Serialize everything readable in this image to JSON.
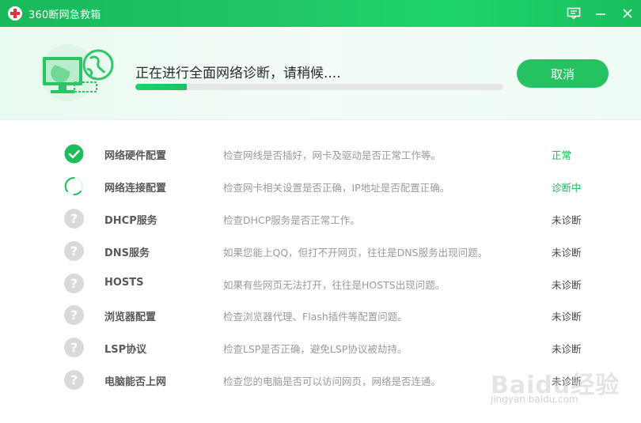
{
  "app": {
    "title": "360断网急救箱",
    "accent": "#21c765"
  },
  "titlebar": {
    "icons": [
      "feedback-icon",
      "minimize-icon",
      "close-icon"
    ]
  },
  "header": {
    "status_text": "正在进行全面网络诊断，请稍候....",
    "progress_fraction": 0.14,
    "cancel_label": "取消"
  },
  "checks": [
    {
      "icon": "check-icon",
      "name": "网络硬件配置",
      "desc": "检查网线是否插好，网卡及驱动是否正常工作等。",
      "status": "正常",
      "state": "ok"
    },
    {
      "icon": "spinner-icon",
      "name": "网络连接配置",
      "desc": "检查网卡相关设置是否正确，IP地址是否配置正确。",
      "status": "诊断中",
      "state": "working"
    },
    {
      "icon": "question-icon",
      "name": "DHCP服务",
      "desc": "检查DHCP服务是否正常工作。",
      "status": "未诊断",
      "state": "pending"
    },
    {
      "icon": "question-icon",
      "name": "DNS服务",
      "desc": "如果您能上QQ，但打不开网页，往往是DNS服务出现问题。",
      "status": "未诊断",
      "state": "pending"
    },
    {
      "icon": "question-icon",
      "name": "HOSTS",
      "desc": "如果有些网页无法打开，往往是HOSTS出现问题。",
      "status": "未诊断",
      "state": "pending"
    },
    {
      "icon": "question-icon",
      "name": "浏览器配置",
      "desc": "检查浏览器代理、Flash插件等配置问题。",
      "status": "未诊断",
      "state": "pending"
    },
    {
      "icon": "question-icon",
      "name": "LSP协议",
      "desc": "检查LSP是否正确，避免LSP协议被劫持。",
      "status": "未诊断",
      "state": "pending"
    },
    {
      "icon": "question-icon",
      "name": "电脑能否上网",
      "desc": "检查您的电脑是否可以访问网页，网络是否连通。",
      "status": "未诊断",
      "state": "pending"
    }
  ],
  "watermark": {
    "text": "Baidu经验",
    "url": "jingyan.baidu.com"
  }
}
